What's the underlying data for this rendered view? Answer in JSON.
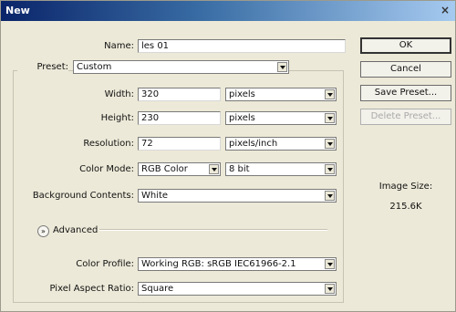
{
  "window": {
    "title": "New",
    "close_glyph": "×"
  },
  "name": {
    "label": "Name:",
    "value": "les 01"
  },
  "preset": {
    "label": "Preset:",
    "value": "Custom"
  },
  "width": {
    "label": "Width:",
    "value": "320",
    "unit": "pixels"
  },
  "height": {
    "label": "Height:",
    "value": "230",
    "unit": "pixels"
  },
  "resolution": {
    "label": "Resolution:",
    "value": "72",
    "unit": "pixels/inch"
  },
  "color_mode": {
    "label": "Color Mode:",
    "value": "RGB Color",
    "bit_depth": "8 bit"
  },
  "background": {
    "label": "Background Contents:",
    "value": "White"
  },
  "advanced": {
    "label": "Advanced",
    "toggle_glyph": "»"
  },
  "color_profile": {
    "label": "Color Profile:",
    "value": "Working RGB:  sRGB IEC61966-2.1"
  },
  "pixel_aspect": {
    "label": "Pixel Aspect Ratio:",
    "value": "Square"
  },
  "buttons": {
    "ok": "OK",
    "cancel": "Cancel",
    "save_preset": "Save Preset...",
    "delete_preset": "Delete Preset..."
  },
  "image_size": {
    "label": "Image Size:",
    "value": "215.6K"
  }
}
